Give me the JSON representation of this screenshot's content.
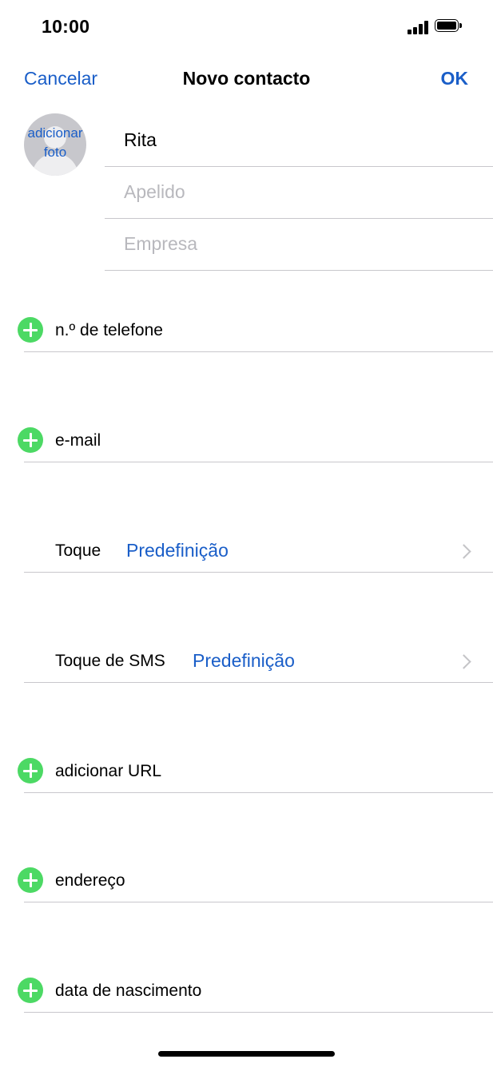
{
  "status_bar": {
    "time": "10:00"
  },
  "nav": {
    "cancel": "Cancelar",
    "title": "Novo contacto",
    "ok": "OK"
  },
  "photo": {
    "label": "adicionar foto"
  },
  "name_fields": [
    {
      "value": "Rita",
      "placeholder": ""
    },
    {
      "value": "",
      "placeholder": "Apelido"
    },
    {
      "value": "",
      "placeholder": "Empresa"
    }
  ],
  "rows": {
    "phone": "n.º de telefone",
    "email": "e-mail",
    "ringtone": {
      "label": "Toque",
      "value": "Predefinição"
    },
    "sms_tone": {
      "label": "Toque de SMS",
      "value": "Predefinição"
    },
    "url": "adicionar URL",
    "address": "endereço",
    "birthday": "data de nascimento"
  },
  "colors": {
    "accent": "#1a5ec8",
    "add": "#4cd964",
    "separator": "#c8c7cc"
  }
}
